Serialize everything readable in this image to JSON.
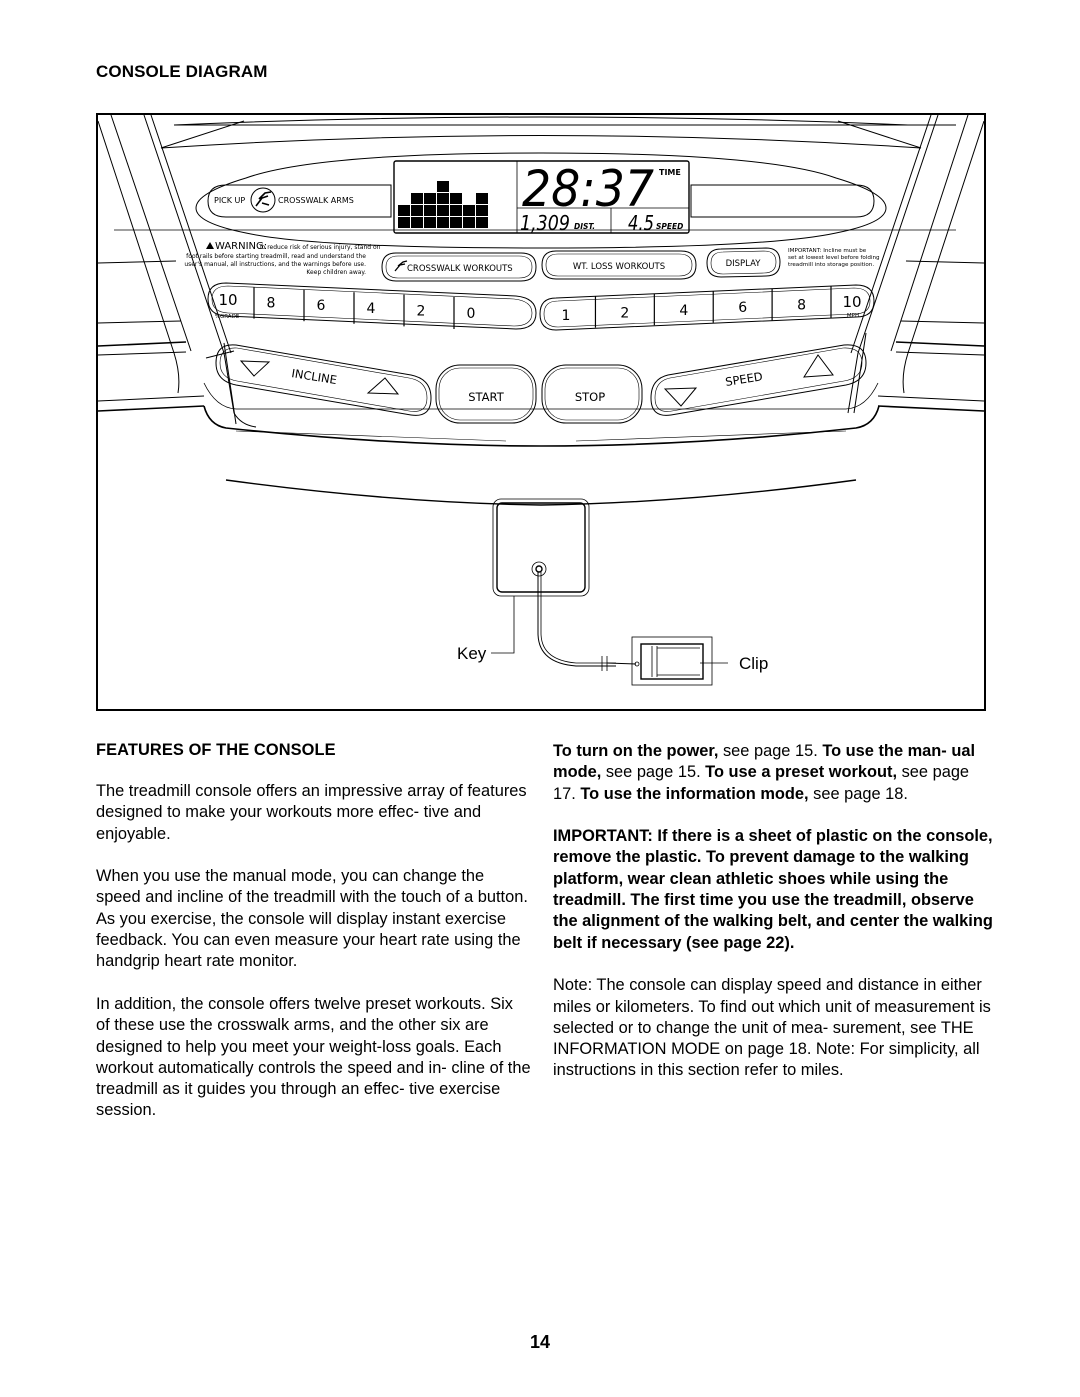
{
  "page": {
    "section_title": "CONSOLE DIAGRAM",
    "page_number": "14"
  },
  "console": {
    "pickup_label_left": "PICK UP",
    "pickup_label_right": "CROSSWALK ARMS",
    "display": {
      "time_value": "28:37",
      "time_label": "TIME",
      "distance_value": "1,309",
      "distance_label": "DIST.",
      "speed_value": "4.5",
      "speed_label": "SPEED",
      "profile_bars": [
        2,
        3,
        3,
        4,
        3,
        2,
        3
      ]
    },
    "warning": {
      "title": "WARNING:",
      "lines": [
        "To reduce risk of serious injury, stand on",
        "foot rails before starting treadmill, read and understand the",
        "user's manual, all instructions, and the warnings before use.",
        "Keep children away."
      ]
    },
    "buttons": {
      "crosswalk_workouts": "CROSSWALK WORKOUTS",
      "wt_loss_workouts": "WT. LOSS WORKOUTS",
      "display": "DISPLAY",
      "incline": "INCLINE",
      "start": "START",
      "stop": "STOP",
      "speed": "SPEED"
    },
    "important_note": [
      "IMPORTANT: Incline must be",
      "set at lowest level before folding",
      "treadmill into storage position."
    ],
    "incline_keys": {
      "values": [
        "10",
        "8",
        "6",
        "4",
        "2",
        "0"
      ],
      "unit": "%GRADE"
    },
    "speed_keys": {
      "values": [
        "1",
        "2",
        "4",
        "6",
        "8",
        "10"
      ],
      "unit": "MPH"
    },
    "callouts": {
      "key": "Key",
      "clip": "Clip"
    }
  },
  "features": {
    "title": "FEATURES OF THE CONSOLE",
    "left_paragraphs": [
      "The treadmill console offers an impressive array of features designed to make your workouts more effec- tive and enjoyable.",
      "When you use the manual mode, you can change the speed and incline of the treadmill with the touch of a button. As you exercise, the console will display instant exercise feedback. You can even measure your heart rate using the handgrip heart rate monitor.",
      "In addition, the console offers twelve preset workouts. Six of these use the crosswalk arms, and the other six are designed to help you meet your weight-loss goals. Each workout automatically controls the speed and in- cline of the treadmill as it guides you through an effec- tive exercise session."
    ],
    "references": [
      {
        "bold": "To turn on the power,",
        "text": " see page 15. "
      },
      {
        "bold": "To use the man- ual mode,",
        "text": " see page 15. "
      },
      {
        "bold": "To use a preset workout,",
        "text": " see page 17. "
      },
      {
        "bold": "To use the information mode,",
        "text": " see page 18."
      }
    ],
    "important": "IMPORTANT: If there is a sheet of plastic on the console, remove the plastic. To prevent damage to the walking platform, wear clean athletic shoes while using the treadmill. The first time you use the treadmill, observe the alignment of the walking belt, and center the walking belt if necessary (see page 22).",
    "note": "Note: The console can display speed and distance in either miles or kilometers. To find out which unit of measurement is selected or to change the unit of mea- surement, see THE INFORMATION MODE on page 18. Note: For simplicity, all instructions in this section refer to miles."
  }
}
